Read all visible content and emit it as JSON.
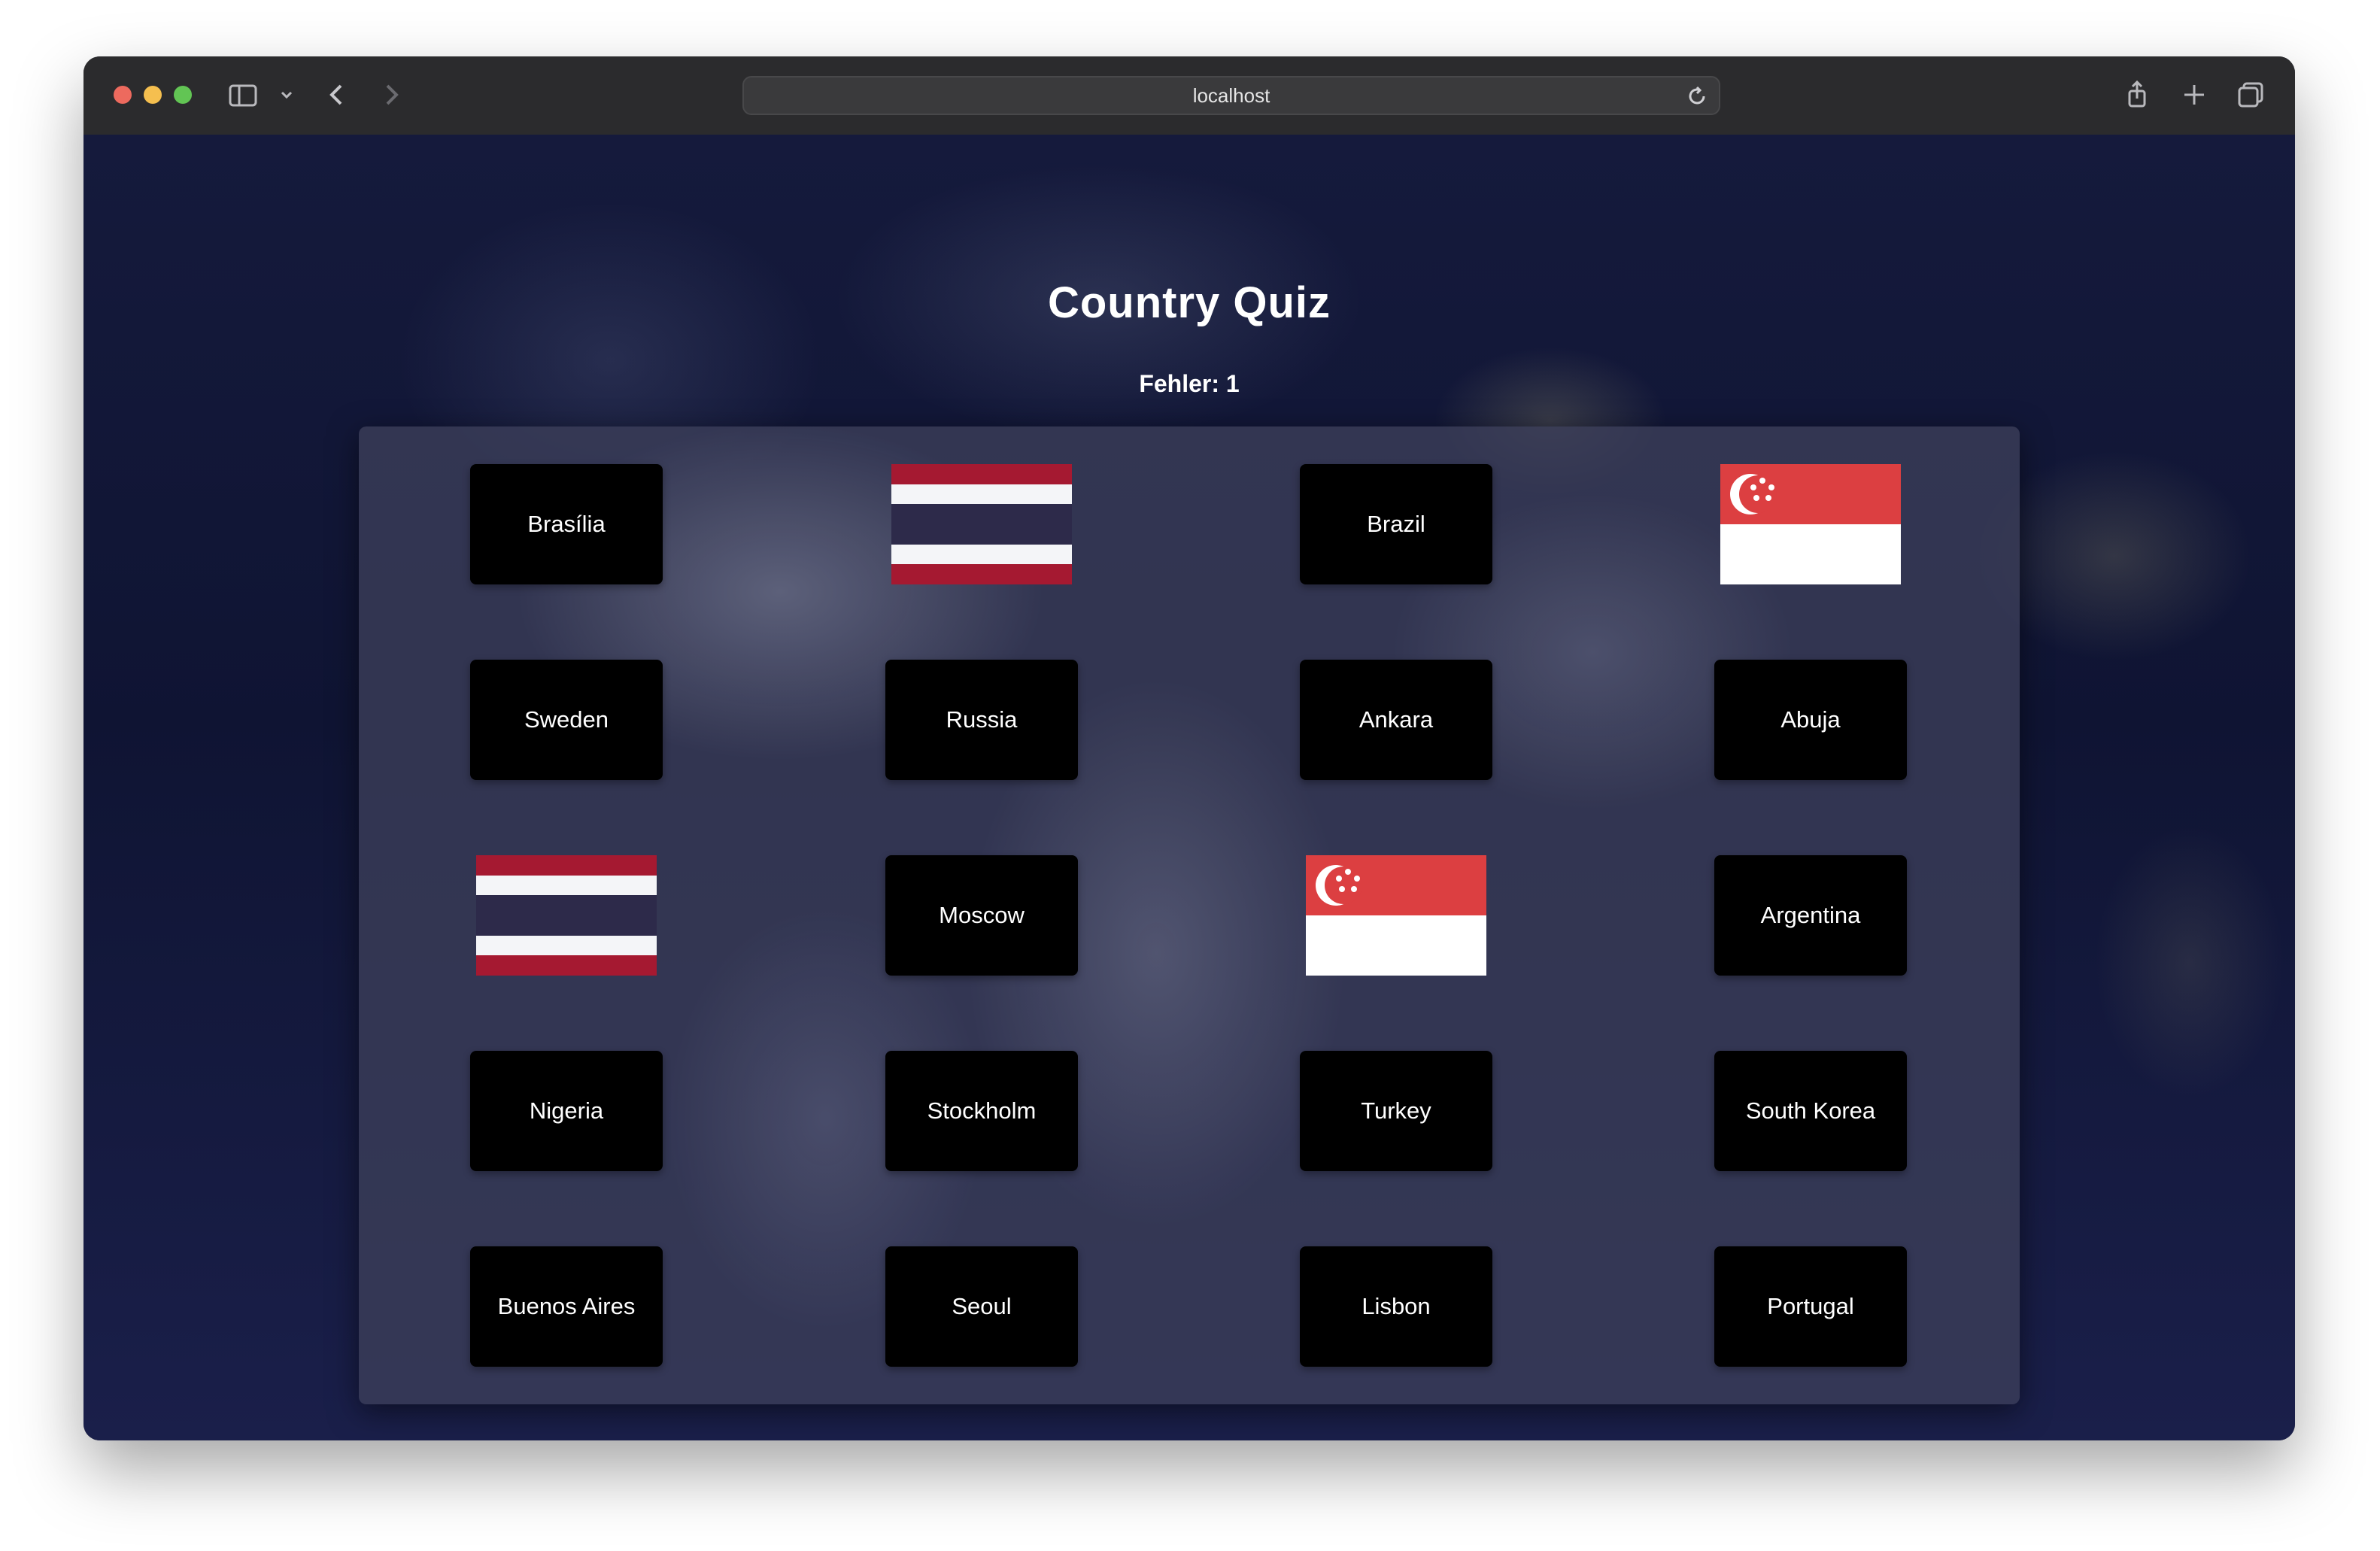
{
  "browser": {
    "url": "localhost"
  },
  "page": {
    "title": "Country Quiz",
    "errors_text": "Fehler: 1"
  },
  "cards": [
    {
      "kind": "text",
      "label": "Brasília"
    },
    {
      "kind": "flag",
      "flag": "thailand"
    },
    {
      "kind": "text",
      "label": "Brazil"
    },
    {
      "kind": "flag",
      "flag": "singapore"
    },
    {
      "kind": "text",
      "label": "Sweden"
    },
    {
      "kind": "text",
      "label": "Russia"
    },
    {
      "kind": "text",
      "label": "Ankara"
    },
    {
      "kind": "text",
      "label": "Abuja"
    },
    {
      "kind": "flag",
      "flag": "thailand"
    },
    {
      "kind": "text",
      "label": "Moscow"
    },
    {
      "kind": "flag",
      "flag": "singapore"
    },
    {
      "kind": "text",
      "label": "Argentina"
    },
    {
      "kind": "text",
      "label": "Nigeria"
    },
    {
      "kind": "text",
      "label": "Stockholm"
    },
    {
      "kind": "text",
      "label": "Turkey"
    },
    {
      "kind": "text",
      "label": "South Korea"
    },
    {
      "kind": "text",
      "label": "Buenos Aires"
    },
    {
      "kind": "text",
      "label": "Seoul"
    },
    {
      "kind": "text",
      "label": "Lisbon"
    },
    {
      "kind": "text",
      "label": "Portugal"
    }
  ],
  "colors": {
    "card_bg": "#000000",
    "thailand_red": "#a51931",
    "thailand_white": "#f4f5f8",
    "thailand_blue": "#2d2a4a",
    "singapore_red": "#dc3f41",
    "singapore_white": "#ffffff"
  }
}
